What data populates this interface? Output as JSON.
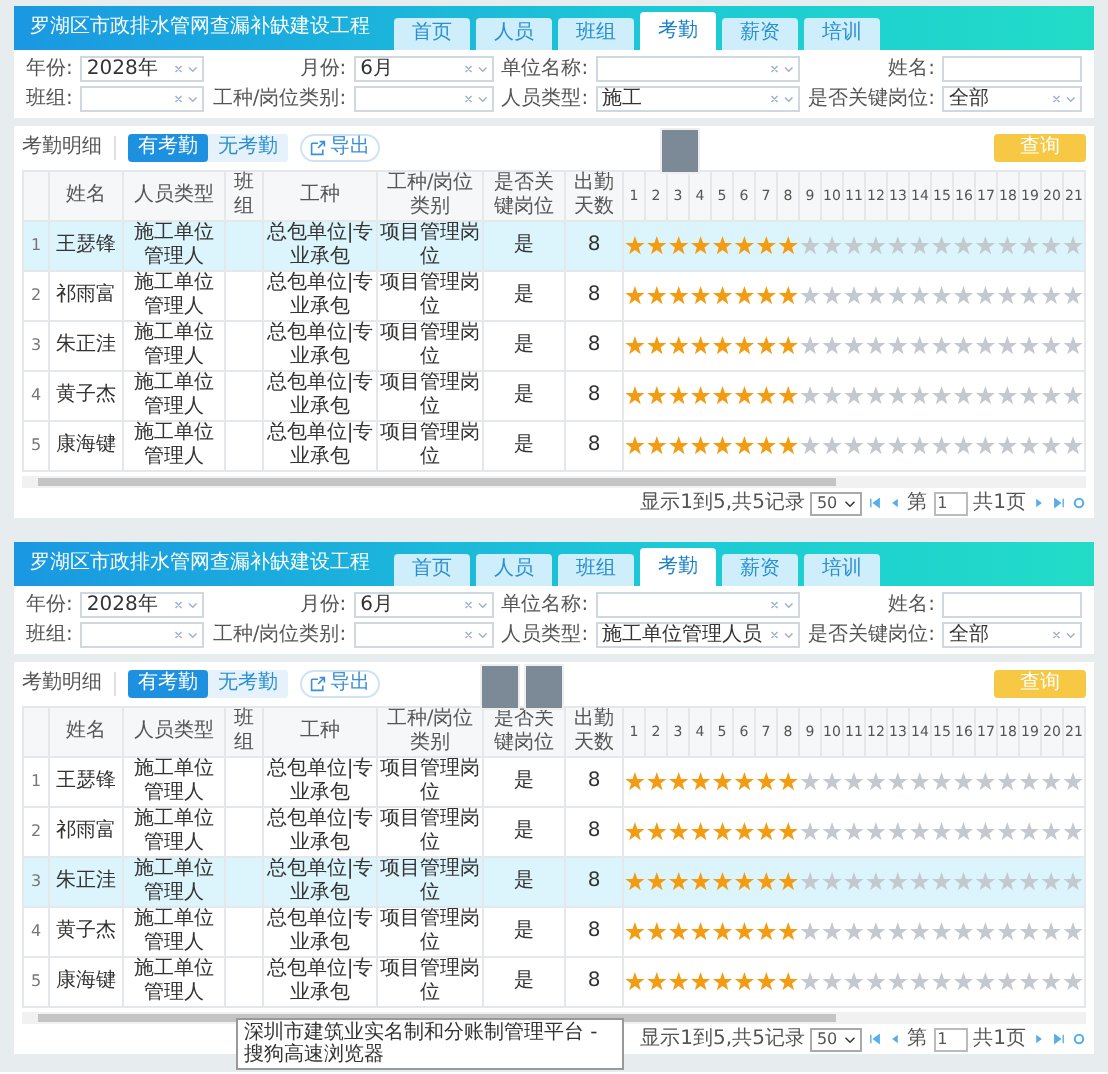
{
  "screens": [
    {
      "title": "罗湖区市政排水管网查漏补缺建设工程",
      "tabs": [
        {
          "label": "首页",
          "selected": false
        },
        {
          "label": "人员",
          "selected": false
        },
        {
          "label": "班组",
          "selected": false
        },
        {
          "label": "考勤",
          "selected": true
        },
        {
          "label": "薪资",
          "selected": false
        },
        {
          "label": "培训",
          "selected": false
        }
      ],
      "filters": [
        {
          "label": "年份:",
          "value": "2028年",
          "kind": "select"
        },
        {
          "label": "月份:",
          "value": "6月",
          "kind": "select"
        },
        {
          "label": "单位名称:",
          "kind": "select"
        },
        {
          "label": "姓名:",
          "kind": "text"
        },
        {
          "label": "班组:",
          "kind": "select"
        },
        {
          "label": "工种/岗位类别:",
          "kind": "select"
        },
        {
          "label": "人员类型:",
          "value": "施工",
          "kind": "select"
        },
        {
          "label": "是否关键岗位:",
          "value": "全部",
          "kind": "select"
        }
      ],
      "section_label": "考勤明细",
      "toggle": [
        {
          "label": "有考勤",
          "selected": true
        },
        {
          "label": "无考勤",
          "selected": false
        }
      ],
      "export_button": "导出",
      "query_button": "查询",
      "columns": [
        "姓名",
        "人员类型",
        "班组",
        "工种",
        "工种/岗位类别",
        "是否关键岗位",
        "出勤天数"
      ],
      "days": [
        "1",
        "2",
        "3",
        "4",
        "5",
        "6",
        "7",
        "8",
        "9",
        "10",
        "11",
        "12",
        "13",
        "14",
        "15",
        "16",
        "17",
        "18",
        "19",
        "20",
        "21"
      ],
      "rows": [
        {
          "index": "1",
          "name": "王瑟锋",
          "type": "施工单位管理人",
          "job": "总包单位|专业承包",
          "category": "项目管理岗位",
          "key": "是",
          "days_count": "8",
          "selected": true,
          "attended": [
            true,
            true,
            true,
            true,
            true,
            true,
            true,
            true,
            false,
            false,
            false,
            false,
            false,
            false,
            false,
            false,
            false,
            false,
            false,
            false,
            false
          ]
        },
        {
          "index": "2",
          "name": "祁雨富",
          "type": "施工单位管理人",
          "job": "总包单位|专业承包",
          "category": "项目管理岗位",
          "key": "是",
          "days_count": "8",
          "selected": false,
          "attended": [
            true,
            true,
            true,
            true,
            true,
            true,
            true,
            true,
            false,
            false,
            false,
            false,
            false,
            false,
            false,
            false,
            false,
            false,
            false,
            false,
            false
          ]
        },
        {
          "index": "3",
          "name": "朱正洼",
          "type": "施工单位管理人",
          "job": "总包单位|专业承包",
          "category": "项目管理岗位",
          "key": "是",
          "days_count": "8",
          "selected": false,
          "attended": [
            true,
            true,
            true,
            true,
            true,
            true,
            true,
            true,
            false,
            false,
            false,
            false,
            false,
            false,
            false,
            false,
            false,
            false,
            false,
            false,
            false
          ]
        },
        {
          "index": "4",
          "name": "黄子杰",
          "type": "施工单位管理人",
          "job": "总包单位|专业承包",
          "category": "项目管理岗位",
          "key": "是",
          "days_count": "8",
          "selected": false,
          "attended": [
            true,
            true,
            true,
            true,
            true,
            true,
            true,
            true,
            false,
            false,
            false,
            false,
            false,
            false,
            false,
            false,
            false,
            false,
            false,
            false,
            false
          ]
        },
        {
          "index": "5",
          "name": "康海键",
          "type": "施工单位管理人",
          "job": "总包单位|专业承包",
          "category": "项目管理岗位",
          "key": "是",
          "days_count": "8",
          "selected": false,
          "attended": [
            true,
            true,
            true,
            true,
            true,
            true,
            true,
            true,
            false,
            false,
            false,
            false,
            false,
            false,
            false,
            false,
            false,
            false,
            false,
            false,
            false
          ]
        }
      ],
      "pager": {
        "summary": "显示1到5,共5记录",
        "page_size": "50",
        "page_label": "第",
        "page": "1",
        "total": "共1页"
      },
      "photos": [
        {
          "kind": "photo"
        }
      ]
    },
    {
      "title": "罗湖区市政排水管网查漏补缺建设工程",
      "tabs": [
        {
          "label": "首页",
          "selected": false
        },
        {
          "label": "人员",
          "selected": false
        },
        {
          "label": "班组",
          "selected": false
        },
        {
          "label": "考勤",
          "selected": true
        },
        {
          "label": "薪资",
          "selected": false
        },
        {
          "label": "培训",
          "selected": false
        }
      ],
      "filters": [
        {
          "label": "年份:",
          "value": "2028年",
          "kind": "select"
        },
        {
          "label": "月份:",
          "value": "6月",
          "kind": "select"
        },
        {
          "label": "单位名称:",
          "kind": "select"
        },
        {
          "label": "姓名:",
          "kind": "text"
        },
        {
          "label": "班组:",
          "kind": "select"
        },
        {
          "label": "工种/岗位类别:",
          "kind": "select"
        },
        {
          "label": "人员类型:",
          "value": "施工单位管理人员",
          "kind": "select"
        },
        {
          "label": "是否关键岗位:",
          "value": "全部",
          "kind": "select"
        }
      ],
      "section_label": "考勤明细",
      "toggle": [
        {
          "label": "有考勤",
          "selected": true
        },
        {
          "label": "无考勤",
          "selected": false
        }
      ],
      "export_button": "导出",
      "query_button": "查询",
      "columns": [
        "姓名",
        "人员类型",
        "班组",
        "工种",
        "工种/岗位类别",
        "是否关键岗位",
        "出勤天数"
      ],
      "days": [
        "1",
        "2",
        "3",
        "4",
        "5",
        "6",
        "7",
        "8",
        "9",
        "10",
        "11",
        "12",
        "13",
        "14",
        "15",
        "16",
        "17",
        "18",
        "19",
        "20",
        "21"
      ],
      "rows": [
        {
          "index": "1",
          "name": "王瑟锋",
          "type": "施工单位管理人",
          "job": "总包单位|专业承包",
          "category": "项目管理岗位",
          "key": "是",
          "days_count": "8",
          "selected": false,
          "attended": [
            true,
            true,
            true,
            true,
            true,
            true,
            true,
            true,
            false,
            false,
            false,
            false,
            false,
            false,
            false,
            false,
            false,
            false,
            false,
            false,
            false
          ]
        },
        {
          "index": "2",
          "name": "祁雨富",
          "type": "施工单位管理人",
          "job": "总包单位|专业承包",
          "category": "项目管理岗位",
          "key": "是",
          "days_count": "8",
          "selected": false,
          "attended": [
            true,
            true,
            true,
            true,
            true,
            true,
            true,
            true,
            false,
            false,
            false,
            false,
            false,
            false,
            false,
            false,
            false,
            false,
            false,
            false,
            false
          ]
        },
        {
          "index": "3",
          "name": "朱正洼",
          "type": "施工单位管理人",
          "job": "总包单位|专业承包",
          "category": "项目管理岗位",
          "key": "是",
          "days_count": "8",
          "selected": true,
          "attended": [
            true,
            true,
            true,
            true,
            true,
            true,
            true,
            true,
            false,
            false,
            false,
            false,
            false,
            false,
            false,
            false,
            false,
            false,
            false,
            false,
            false
          ]
        },
        {
          "index": "4",
          "name": "黄子杰",
          "type": "施工单位管理人",
          "job": "总包单位|专业承包",
          "category": "项目管理岗位",
          "key": "是",
          "days_count": "8",
          "selected": false,
          "attended": [
            true,
            true,
            true,
            true,
            true,
            true,
            true,
            true,
            false,
            false,
            false,
            false,
            false,
            false,
            false,
            false,
            false,
            false,
            false,
            false,
            false
          ]
        },
        {
          "index": "5",
          "name": "康海键",
          "type": "施工单位管理人",
          "job": "总包单位|专业承包",
          "category": "项目管理岗位",
          "key": "是",
          "days_count": "8",
          "selected": false,
          "attended": [
            true,
            true,
            true,
            true,
            true,
            true,
            true,
            true,
            false,
            false,
            false,
            false,
            false,
            false,
            false,
            false,
            false,
            false,
            false,
            false,
            false
          ]
        }
      ],
      "pager": {
        "summary": "显示1到5,共5记录",
        "page_size": "50",
        "page_label": "第",
        "page": "1",
        "total": "共1页"
      },
      "photos": [
        {
          "kind": "photo"
        },
        {
          "kind": "photo"
        }
      ],
      "tooltip": "深圳市建筑业实名制和分账制管理平台 - 搜狗高速浏览器"
    }
  ]
}
